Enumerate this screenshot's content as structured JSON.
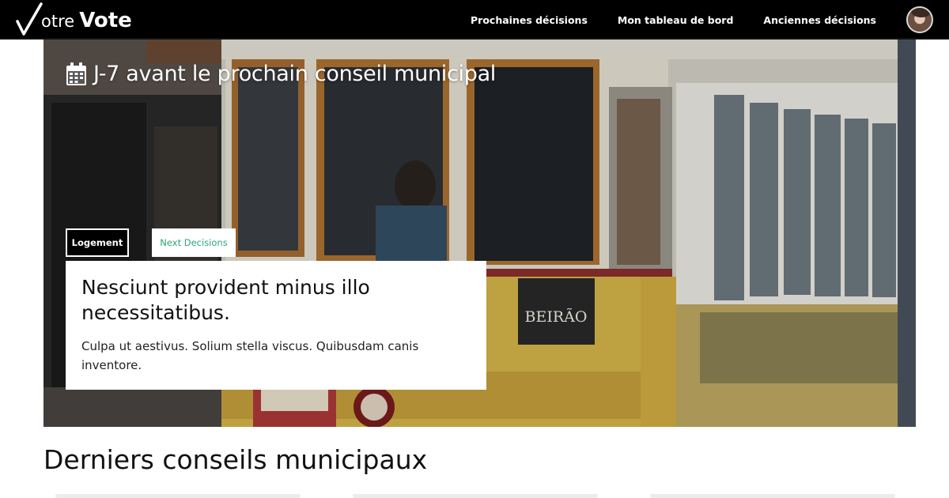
{
  "navbar": {
    "brand_light": "otre",
    "brand_bold": "Vote",
    "links": [
      {
        "label": "Prochaines décisions"
      },
      {
        "label": "Mon tableau de bord"
      },
      {
        "label": "Anciennes décisions"
      }
    ],
    "avatar_icon": "user-avatar"
  },
  "hero": {
    "countdown": "J-7 avant le prochain conseil municipal",
    "countdown_icon": "calendar-icon",
    "tags": [
      {
        "label": "Logement"
      },
      {
        "label": "Next Decisions"
      }
    ],
    "card": {
      "title": "Nesciunt provident minus illo necessitatibus.",
      "text": "Culpa ut aestivus. Solium stella viscus. Quibusdam canis inventore."
    }
  },
  "section": {
    "title": "Derniers conseils municipaux"
  },
  "colors": {
    "navbar": "#000000",
    "accent_green": "#2aa876",
    "tram_yellow": "#d9b84a"
  }
}
